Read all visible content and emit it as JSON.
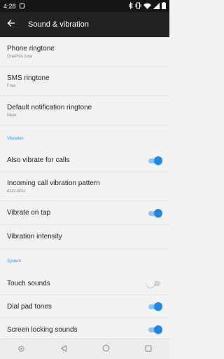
{
  "status": {
    "time": "4:28"
  },
  "appbar": {
    "title": "Sound & vibration"
  },
  "ringtones": [
    {
      "title": "Phone ringtone",
      "subtitle": "OnePlus tune"
    },
    {
      "title": "SMS ringtone",
      "subtitle": "Free"
    },
    {
      "title": "Default notification ringtone",
      "subtitle": "Meet"
    }
  ],
  "vibration": {
    "header": "Vibration",
    "also_vibrate": {
      "label": "Also vibrate for calls",
      "on": true
    },
    "pattern": {
      "label": "Incoming call vibration pattern",
      "value": "dzzz-dzzz"
    },
    "vibrate_tap": {
      "label": "Vibrate on tap",
      "on": true
    },
    "intensity": {
      "label": "Vibration intensity"
    }
  },
  "system": {
    "header": "System",
    "touch_sounds": {
      "label": "Touch sounds",
      "on": false
    },
    "dial_pad": {
      "label": "Dial pad tones",
      "on": true
    },
    "screen_lock": {
      "label": "Screen locking sounds",
      "on": true
    }
  },
  "icons": {
    "back": "arrow-left-icon",
    "wifi": "wifi-icon",
    "signal": "signal-icon",
    "battery": "battery-icon"
  },
  "colors": {
    "accent": "#1e88e5",
    "appbar": "#232323"
  }
}
